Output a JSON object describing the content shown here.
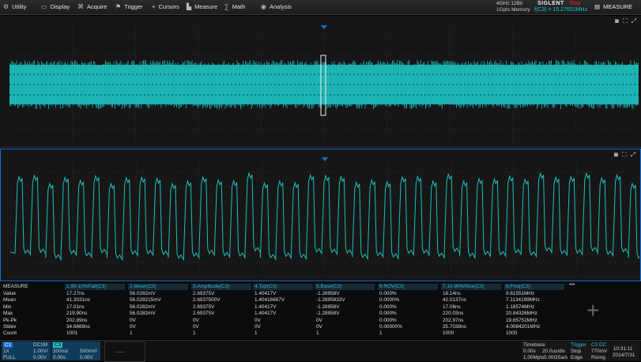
{
  "menu": [
    {
      "label": "Utility",
      "icon": "utility-icon",
      "glyph": "⚙"
    },
    {
      "label": "Display",
      "icon": "display-icon",
      "glyph": "▭"
    },
    {
      "label": "Acquire",
      "icon": "acquire-icon",
      "glyph": "⌘"
    },
    {
      "label": "Trigger",
      "icon": "trigger-icon",
      "glyph": "⚑"
    },
    {
      "label": "Cursors",
      "icon": "cursors-icon",
      "glyph": "⌖"
    },
    {
      "label": "Measure",
      "icon": "measure-icon",
      "glyph": "▙"
    },
    {
      "label": "Math",
      "icon": "math-icon",
      "glyph": "∑"
    },
    {
      "label": "Analysis",
      "icon": "analysis-icon",
      "glyph": "◉"
    }
  ],
  "top_info": {
    "line1": "4GHz 12Bit",
    "line2": "1Gpts Memory"
  },
  "brand": "SIGLENT",
  "state": "Stop",
  "freq": "f(C3) = 15.27651MHz",
  "measure_label": "MEASURE",
  "colors": {
    "trace": "#1fbfbf",
    "accent": "#1a6fd0",
    "grid": "#3a3a3a"
  },
  "measurements": {
    "title": "MEASURE",
    "headers": [
      "1.90-10%Fall(C3)",
      "2.Mean(C3)",
      "3.Amplitude(C3)",
      "4.Top(C3)",
      "5.Base(C3)",
      "6.ROV(C3)",
      "7.10-90%Rise(C3)",
      "8.Freq(C3)"
    ],
    "rows": [
      {
        "label": "Value",
        "cells": [
          "17.27ns",
          "56.0282mV",
          "2.69375V",
          "1.40417V",
          "-1.28958V",
          "0.000%",
          "18.14ns",
          "9.61551MHz"
        ]
      },
      {
        "label": "Mean",
        "cells": [
          "41.3031ns",
          "56.028215mV",
          "2.6937500V",
          "1.40416667V",
          "-1.2895833V",
          "0.0000%",
          "42.0137ns",
          "7.1134199MHz"
        ]
      },
      {
        "label": "Min",
        "cells": [
          "17.01ns",
          "56.0282mV",
          "2.69375V",
          "1.40417V",
          "-1.28958V",
          "0.000%",
          "17.06ns",
          "1.18574MHz"
        ]
      },
      {
        "label": "Max",
        "cells": [
          "219.90ns",
          "56.0282mV",
          "2.69375V",
          "1.40417V",
          "-1.28958V",
          "0.000%",
          "220.03ns",
          "20.84326MHz"
        ]
      },
      {
        "label": "Pk-Pk",
        "cells": [
          "202.89ns",
          "0V",
          "0V",
          "0V",
          "0V",
          "0.000%",
          "202.97ns",
          "19.65752MHz"
        ]
      },
      {
        "label": "Stdev",
        "cells": [
          "34.6669ns",
          "0V",
          "0V",
          "0V",
          "0V",
          "0.00000%",
          "35.7038ns",
          "4.0084201MHz"
        ]
      },
      {
        "label": "Count",
        "cells": [
          "1001",
          "1",
          "1",
          "1",
          "1",
          "1",
          "1000",
          "1000"
        ]
      }
    ]
  },
  "bottom": {
    "ch1": {
      "name": "C1",
      "coupling": "DC1M",
      "probe": "1X",
      "scale": "1.00V/",
      "bw": "FULL",
      "offset": "0.00V"
    },
    "ch3": {
      "name": "C3",
      "delay": "200ns/",
      "delay2": "0.00s",
      "scale": "500mV/",
      "offset": "0.00V"
    },
    "timebase": {
      "title": "Timebase",
      "pos": "0.00s",
      "div": "20.0us/div",
      "rate": "1.00Mpts",
      "sa": "5.00GSa/s"
    },
    "trigger": {
      "title": "Trigger",
      "src": "C3 DC",
      "mode": "Stop",
      "level": "770mV",
      "type": "Edge",
      "slope": "Rising"
    },
    "clock": {
      "time": "10:31:11",
      "date": "2014/7/31"
    }
  }
}
